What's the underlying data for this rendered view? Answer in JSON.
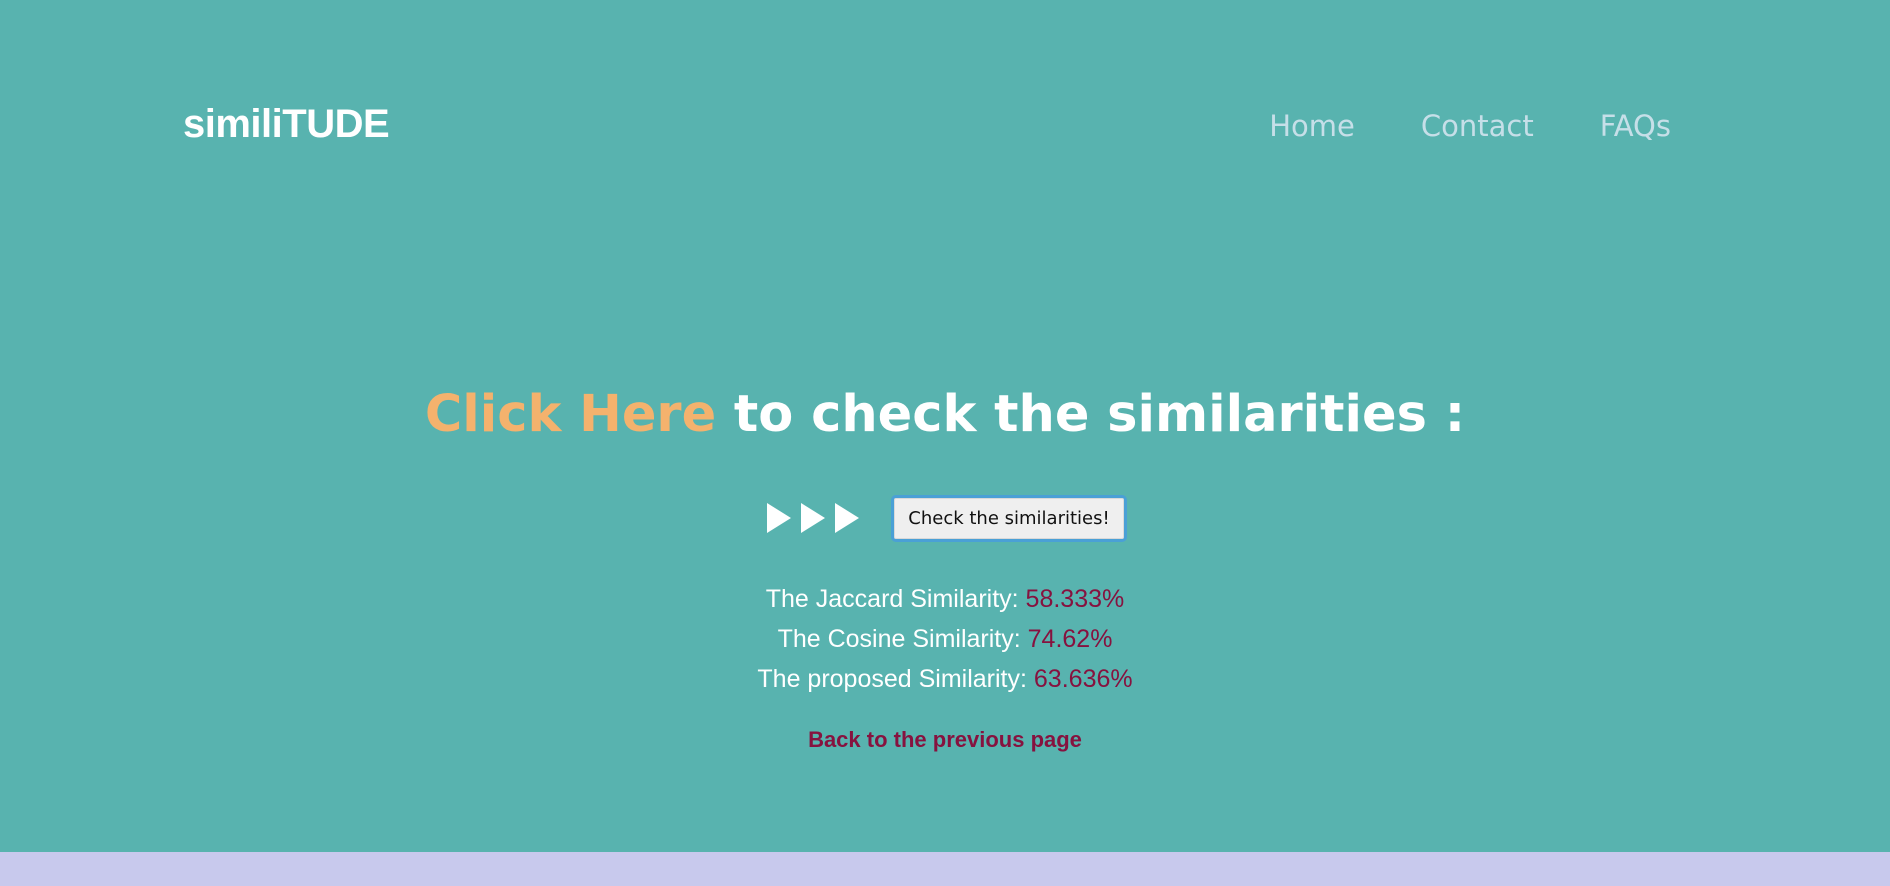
{
  "navbar": {
    "brand": "similiTUDE",
    "links": [
      "Home",
      "Contact",
      "FAQs"
    ]
  },
  "hero": {
    "highlight": "Click Here",
    "title_rest": " to check the similarities :"
  },
  "action": {
    "button_label": "Check the similarities!"
  },
  "results": [
    {
      "label": "The Jaccard Similarity: ",
      "value": "58.333%"
    },
    {
      "label": "The Cosine Similarity: ",
      "value": "74.62%"
    },
    {
      "label": "The proposed Similarity: ",
      "value": "63.636%"
    }
  ],
  "back_link": "Back to the previous page",
  "colors": {
    "background": "#58b3af",
    "accent": "#f4b26d",
    "value": "#86123f",
    "footer": "#c8c9ed"
  }
}
